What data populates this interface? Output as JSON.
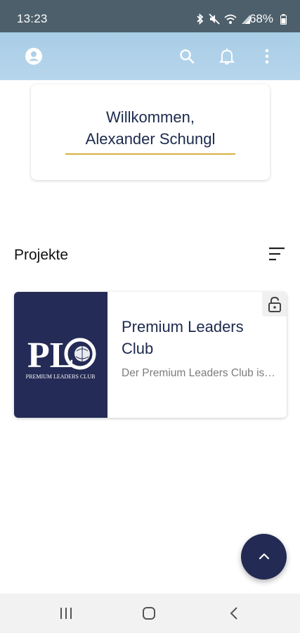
{
  "status_bar": {
    "time": "13:23",
    "battery": "68%",
    "icons": [
      "bluetooth-icon",
      "mute-icon",
      "wifi-icon",
      "signal-icon",
      "battery-icon"
    ]
  },
  "app_bar": {
    "icons": [
      "account-icon",
      "search-icon",
      "bell-icon",
      "more-vert-icon"
    ],
    "color": "#b0d2ea"
  },
  "welcome": {
    "line1": "Willkommen,",
    "line2": "Alexander Schungl",
    "accent": "#d6b040"
  },
  "projects_section": {
    "title": "Projekte",
    "sort_icon": "sort-icon"
  },
  "projects": [
    {
      "title": "Premium Leaders Club",
      "description": "Der Premium Leaders Club ist ein Business-Netzwerk f...",
      "logo_text": "PLC",
      "logo_caption": "PREMIUM LEADERS CLUB",
      "logo_bg": "#242b56",
      "lock_icon": "unlock-icon"
    }
  ],
  "fab": {
    "icon": "chevron-up-icon",
    "color": "#232b54"
  },
  "nav_bar": {
    "icons": [
      "recents-icon",
      "home-icon",
      "back-icon"
    ]
  }
}
